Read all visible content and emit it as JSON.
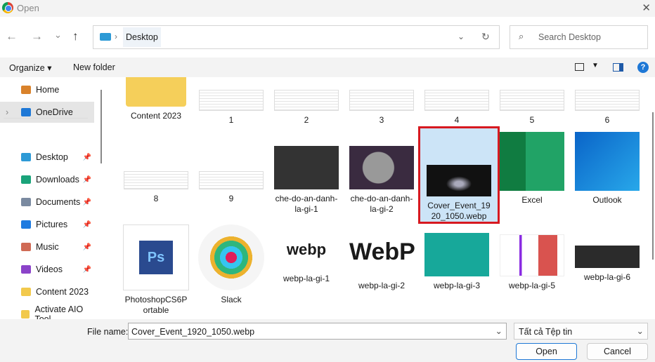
{
  "window": {
    "title": "Open",
    "close": "✕"
  },
  "nav": {
    "back": "←",
    "forward": "→",
    "recent": "⌄",
    "up": "↑",
    "breadcrumb": "Desktop",
    "refresh": "↻",
    "search_placeholder": "Search Desktop"
  },
  "toolbar": {
    "organize": "Organize ▾",
    "new_folder": "New folder",
    "help": "?"
  },
  "sidebar": {
    "items": [
      {
        "label": "Home",
        "color": "#d9822b"
      },
      {
        "label": "OneDrive",
        "color": "#1e78d6"
      },
      {
        "label": "Desktop",
        "color": "#2d9ad6"
      },
      {
        "label": "Downloads",
        "color": "#1aa37a"
      },
      {
        "label": "Documents",
        "color": "#7a8aa0"
      },
      {
        "label": "Pictures",
        "color": "#1f7be0"
      },
      {
        "label": "Music",
        "color": "#d06a55"
      },
      {
        "label": "Videos",
        "color": "#8b43c9"
      },
      {
        "label": "Content 2023",
        "color": "#f2c94c"
      },
      {
        "label": "Activate AIO Tool",
        "color": "#f2c94c"
      }
    ]
  },
  "files": [
    {
      "name": "Content 2023"
    },
    {
      "name": "1"
    },
    {
      "name": "2"
    },
    {
      "name": "3"
    },
    {
      "name": "4"
    },
    {
      "name": "5"
    },
    {
      "name": "6"
    },
    {
      "name": "8"
    },
    {
      "name": "9"
    },
    {
      "name": "che-do-an-danh-la-gi-1"
    },
    {
      "name": "che-do-an-danh-la-gi-2"
    },
    {
      "name": "Cover_Event_1920_1050.webp"
    },
    {
      "name": "Excel"
    },
    {
      "name": "Outlook"
    },
    {
      "name": "PhotoshopCS6Portable"
    },
    {
      "name": "Slack"
    },
    {
      "name": "webp-la-gi-1"
    },
    {
      "name": "webp-la-gi-2"
    },
    {
      "name": "webp-la-gi-3"
    },
    {
      "name": "webp-la-gi-5"
    },
    {
      "name": "webp-la-gi-6"
    }
  ],
  "footer": {
    "file_name_label": "File name:",
    "file_name_value": "Cover_Event_1920_1050.webp",
    "file_type": "Tất cả Tệp tin",
    "open": "Open",
    "cancel": "Cancel"
  }
}
